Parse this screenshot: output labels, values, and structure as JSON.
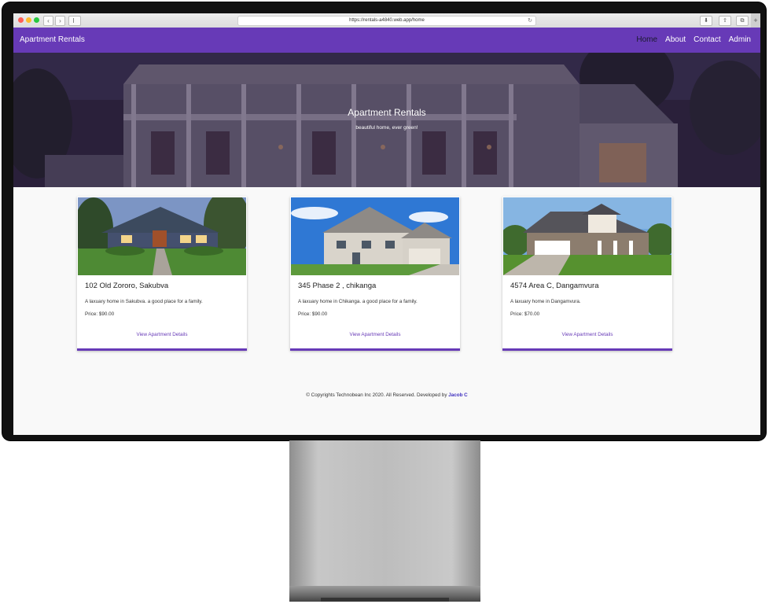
{
  "browser": {
    "url": "https://rentals-a4840.web.app/home"
  },
  "navbar": {
    "brand": "Apartment Rentals",
    "items": [
      {
        "label": "Home"
      },
      {
        "label": "About"
      },
      {
        "label": "Contact"
      },
      {
        "label": "Admin"
      }
    ]
  },
  "hero": {
    "title": "Apartment Rentals",
    "subtitle": "beautiful home, ever green!"
  },
  "listings": [
    {
      "title": "102 Old Zororo, Sakubva",
      "description": "A laxuary home in Sakubva. a good place for a family.",
      "price": "Price: $90.00",
      "link": "View Apartment Details"
    },
    {
      "title": "345 Phase 2 , chikanga",
      "description": "A laxuary home in Chikanga. a good place for a family.",
      "price": "Price: $90.00",
      "link": "View Apartment Details"
    },
    {
      "title": "4574 Area C, Dangamvura",
      "description": "A laxuary home in Dangamvura.",
      "price": "Price: $70.00",
      "link": "View Apartment Details"
    }
  ],
  "footer": {
    "text": "© Copyrights Technobean Inc 2020. All Reserved. Developed by",
    "developer": "Jacob C"
  },
  "colors": {
    "primary": "#673ab7"
  }
}
